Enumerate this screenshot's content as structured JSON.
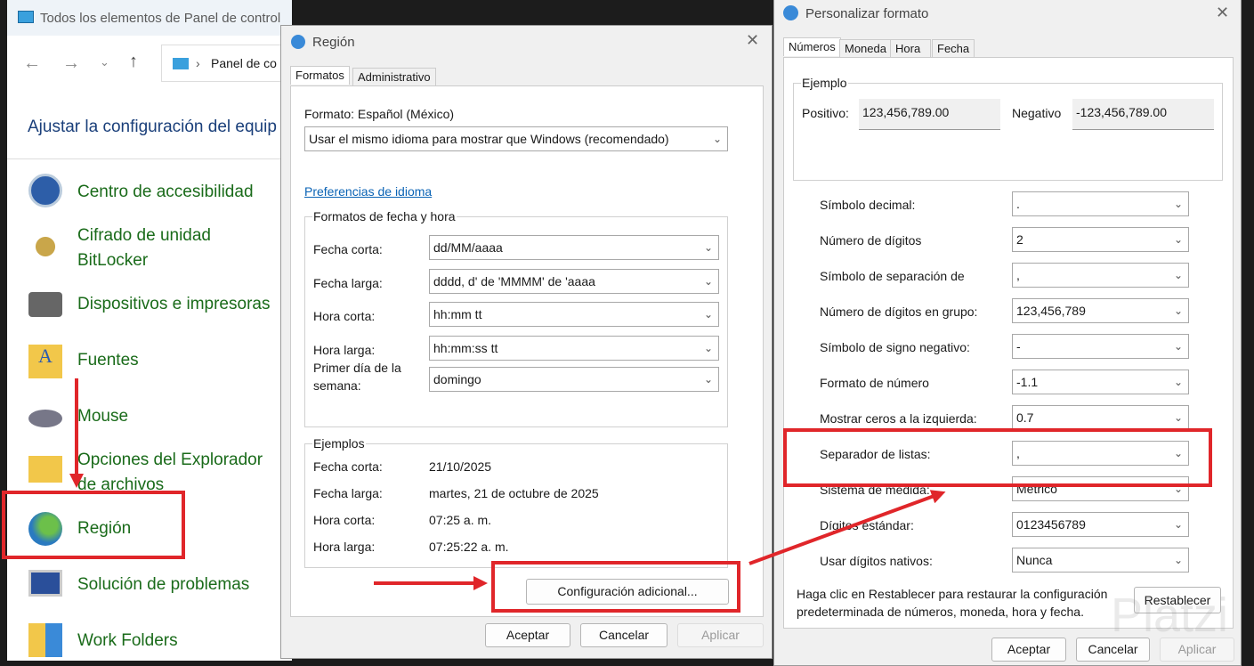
{
  "control_panel": {
    "title": "Todos los elementos de Panel de control",
    "breadcrumb": "Panel de co",
    "heading": "Ajustar la configuración del equip",
    "items": [
      {
        "label": "Centro de accesibilidad"
      },
      {
        "label": "Cifrado de unidad\nBitLocker"
      },
      {
        "label": "Dispositivos e impresoras"
      },
      {
        "label": "Fuentes"
      },
      {
        "label": "Mouse"
      },
      {
        "label": "Opciones del Explorador\nde archivos"
      },
      {
        "label": "Región"
      },
      {
        "label": "Solución de problemas"
      },
      {
        "label": "Work Folders"
      }
    ]
  },
  "region": {
    "title": "Región",
    "tabs": [
      "Formatos",
      "Administrativo"
    ],
    "format_label": "Formato: Español (México)",
    "format_value": "Usar el mismo idioma para mostrar que Windows (recomendado)",
    "lang_link": "Preferencias de idioma",
    "date_group": "Formatos de fecha y hora",
    "date_rows": [
      {
        "label": "Fecha corta:",
        "value": "dd/MM/aaaa"
      },
      {
        "label": "Fecha larga:",
        "value": "dddd, d' de 'MMMM' de 'aaaa"
      },
      {
        "label": "Hora corta:",
        "value": "hh:mm tt"
      },
      {
        "label": "Hora larga:",
        "value": "hh:mm:ss tt"
      },
      {
        "label": "Primer día de la\nsemana:",
        "value": "domingo"
      }
    ],
    "examples_group": "Ejemplos",
    "examples": [
      {
        "label": "Fecha corta:",
        "value": "21/10/2025"
      },
      {
        "label": "Fecha larga:",
        "value": "martes, 21 de octubre de 2025"
      },
      {
        "label": "Hora corta:",
        "value": "07:25 a. m."
      },
      {
        "label": "Hora larga:",
        "value": "07:25:22 a. m."
      }
    ],
    "additional_btn": "Configuración adicional...",
    "ok": "Aceptar",
    "cancel": "Cancelar",
    "apply": "Aplicar"
  },
  "custom": {
    "title": "Personalizar formato",
    "tabs": [
      "Números",
      "Moneda",
      "Hora",
      "Fecha"
    ],
    "example_group": "Ejemplo",
    "positive_label": "Positivo:",
    "positive_value": "123,456,789.00",
    "negative_label": "Negativo",
    "negative_value": "-123,456,789.00",
    "rows": [
      {
        "label": "Símbolo decimal:",
        "value": "."
      },
      {
        "label": "Número de dígitos",
        "value": "2"
      },
      {
        "label": "Símbolo de separación de",
        "value": ","
      },
      {
        "label": "Número de dígitos en grupo:",
        "value": "123,456,789"
      },
      {
        "label": "Símbolo de signo negativo:",
        "value": "-"
      },
      {
        "label": "Formato de número",
        "value": "-1.1"
      },
      {
        "label": "Mostrar ceros a la izquierda:",
        "value": "0.7"
      },
      {
        "label": "Separador de listas:",
        "value": ","
      },
      {
        "label": "Sistema de medida:",
        "value": "Métrico"
      },
      {
        "label": "Dígitos estándar:",
        "value": "0123456789"
      },
      {
        "label": "Usar dígitos nativos:",
        "value": "Nunca"
      }
    ],
    "reset_text": "Haga clic en Restablecer para restaurar la configuración\npredeterminada de números, moneda, hora y fecha.",
    "reset_btn": "Restablecer",
    "ok": "Aceptar",
    "cancel": "Cancelar",
    "apply": "Aplicar",
    "watermark": "Platzi"
  },
  "colors": {
    "annotation": "#e0262a",
    "link": "#0a63b5",
    "item_green": "#1a6b1a"
  }
}
